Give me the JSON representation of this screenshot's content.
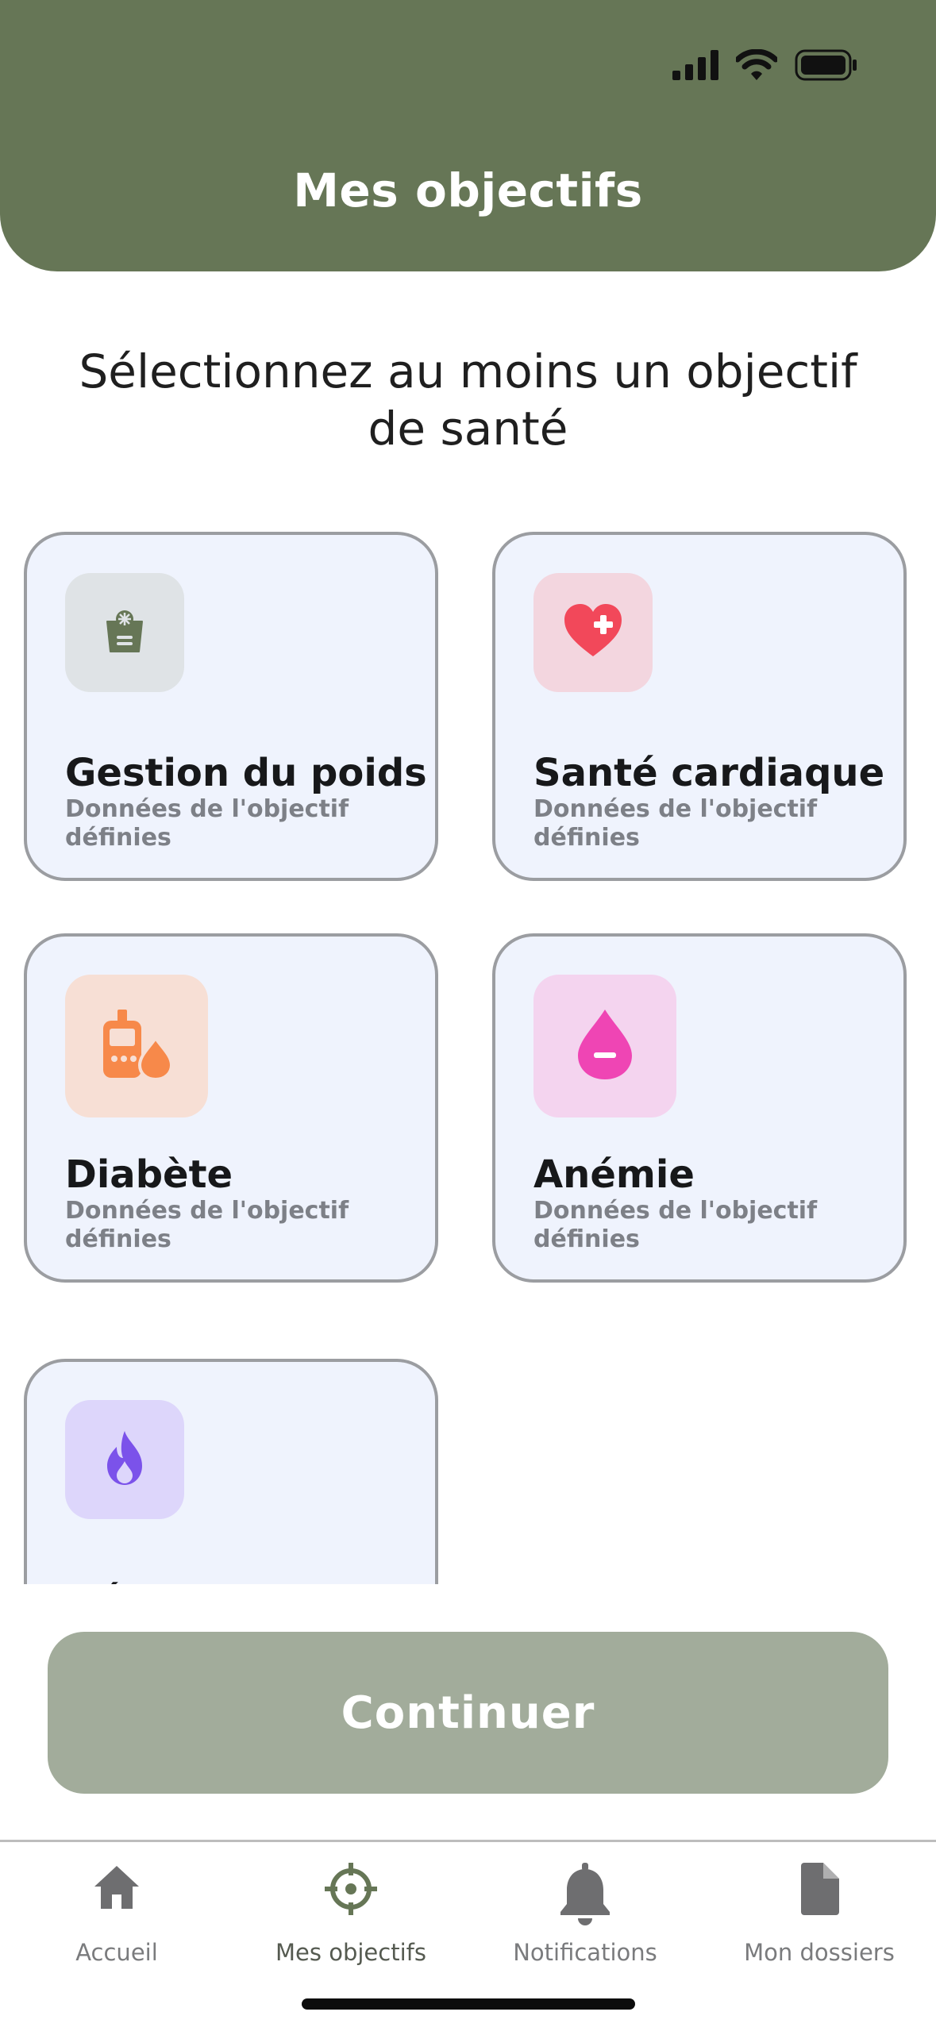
{
  "header": {
    "title": "Mes objectifs"
  },
  "status_bar": {
    "icons": [
      "signal-icon",
      "wifi-icon",
      "battery-icon"
    ]
  },
  "prompt": {
    "text": "Sélectionnez au moins un objectif de santé"
  },
  "goals": [
    {
      "title": "Gestion du poids",
      "subtitle": "Données de l'objectif définies",
      "icon": "weight-scale-icon",
      "tile_color": "#dfe3e6",
      "icon_color": "#667656"
    },
    {
      "title": "Santé cardiaque",
      "subtitle": "Données de l'objectif définies",
      "icon": "heart-plus-icon",
      "tile_color": "#f3d6df",
      "icon_color": "#f2485a"
    },
    {
      "title": "Diabète",
      "subtitle": "Données de l'objectif définies",
      "icon": "glucometer-icon",
      "tile_color": "#f7dfd5",
      "icon_color": "#f7894a"
    },
    {
      "title": "Anémie",
      "subtitle": "Données de l'objectif définies",
      "icon": "blood-drop-minus-icon",
      "tile_color": "#f4d4ef",
      "icon_color": "#ef45b4"
    },
    {
      "title": "Dépense",
      "subtitle": "",
      "icon": "flame-icon",
      "tile_color": "#ddd6fb",
      "icon_color": "#7b52ea"
    }
  ],
  "actions": {
    "continue_label": "Continuer"
  },
  "bottom_nav": {
    "items": [
      {
        "label": "Accueil",
        "icon": "home-icon"
      },
      {
        "label": "Mes objectifs",
        "icon": "target-icon",
        "active": true
      },
      {
        "label": "Notifications",
        "icon": "bell-icon"
      },
      {
        "label": "Mon dossiers",
        "icon": "document-icon"
      }
    ]
  },
  "colors": {
    "brand": "#667656",
    "button": "#a2ac9b",
    "card_bg": "#eff3fd",
    "card_border": "#9b9da1"
  }
}
